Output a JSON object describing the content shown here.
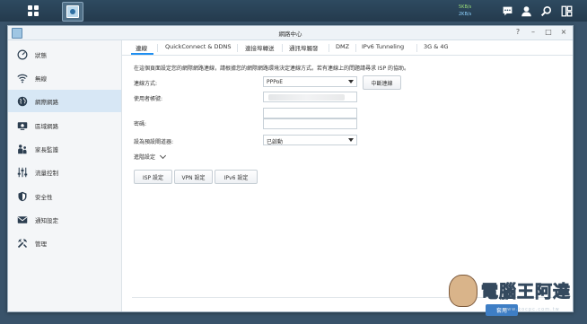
{
  "desktop": {
    "speed_up": "5KB/s",
    "speed_down": "2KB/s"
  },
  "window": {
    "title": "網路中心",
    "controls": [
      "?",
      "–",
      "□",
      "×"
    ]
  },
  "sidebar": {
    "items": [
      {
        "label": "狀態",
        "icon": "gauge-icon"
      },
      {
        "label": "無線",
        "icon": "wifi-icon"
      },
      {
        "label": "網際網路",
        "icon": "globe-icon",
        "active": true
      },
      {
        "label": "區域網路",
        "icon": "home-network-icon"
      },
      {
        "label": "家長監護",
        "icon": "family-icon"
      },
      {
        "label": "流量控制",
        "icon": "sliders-icon"
      },
      {
        "label": "安全性",
        "icon": "shield-icon"
      },
      {
        "label": "通知設定",
        "icon": "notification-icon"
      },
      {
        "label": "管理",
        "icon": "tools-icon"
      }
    ]
  },
  "tabs": [
    {
      "label": "連線",
      "active": true
    },
    {
      "label": "QuickConnect & DDNS"
    },
    {
      "label": "連接埠轉送"
    },
    {
      "label": "通訊埠觸發"
    },
    {
      "label": "DMZ"
    },
    {
      "label": "IPv6 Tunneling"
    },
    {
      "label": "3G & 4G"
    }
  ],
  "connection": {
    "description": "在這個頁面設定您的網際網路連線，請根據您的網際網路環境決定連線方式。若有連線上的問題請尋求 ISP 的協助。",
    "type_label": "連線方式:",
    "type_value": "PPPoE",
    "disconnect_button": "中斷連線",
    "username_label": "使用者帳號:",
    "password_label": "密碼:",
    "default_gateway_label": "設為預設閘道器:",
    "default_gateway_value": "已啟動",
    "advanced_label": "進階設定",
    "isp_button": "ISP 設定",
    "vpn_button": "VPN 設定",
    "ipv6_button": "IPv6 設定",
    "apply_button": "套用"
  },
  "watermark": {
    "text": "電腦王阿達",
    "url": "www.kocpc.com.tw"
  },
  "colors": {
    "accent": "#1f8ff1",
    "sidebar_active": "#d7e7f5",
    "desktop": "#2e4a60"
  }
}
